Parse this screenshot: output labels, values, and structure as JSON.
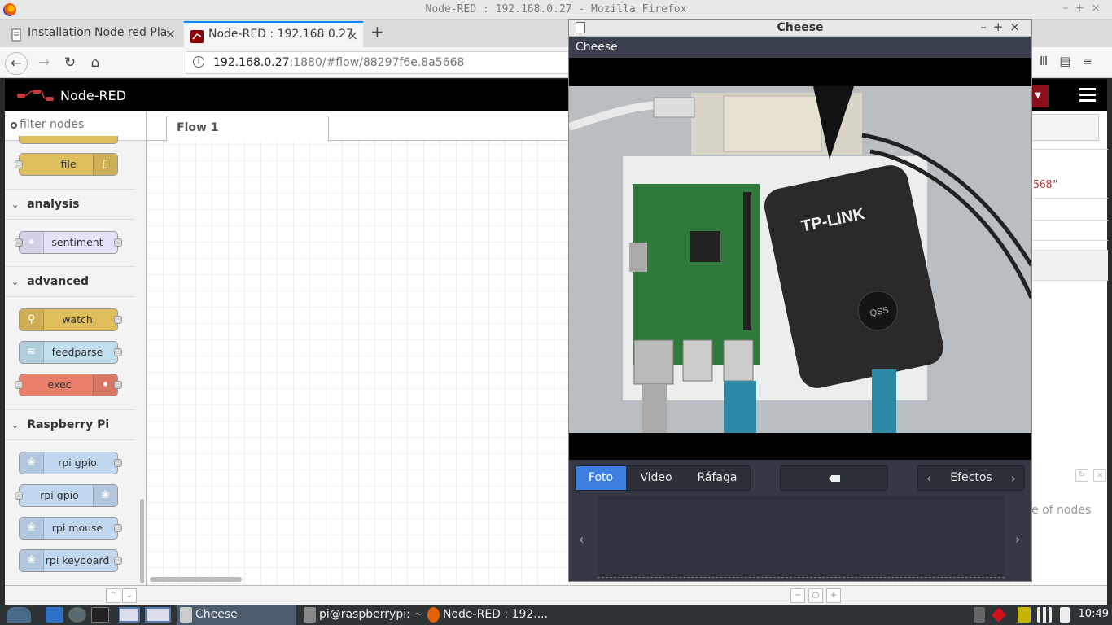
{
  "browser": {
    "window_title": "Node-RED : 192.168.0.27 - Mozilla Firefox",
    "tabs": [
      {
        "label": "Installation Node red Pla",
        "active": false
      },
      {
        "label": "Node-RED : 192.168.0.27",
        "active": true
      }
    ],
    "url_host": "192.168.0.27",
    "url_rest": ":1880/#flow/88297f6e.8a5668"
  },
  "nodered": {
    "app_title": "Node-RED",
    "filter_placeholder": "filter nodes",
    "palette": {
      "nodes_top": [
        {
          "label": "file",
          "color": "#debd5c"
        }
      ],
      "categories": [
        {
          "name": "analysis",
          "nodes": [
            {
              "label": "sentiment",
              "color": "#e6e0f8"
            }
          ]
        },
        {
          "name": "advanced",
          "nodes": [
            {
              "label": "watch",
              "color": "#debd5c"
            },
            {
              "label": "feedparse",
              "color": "#c0deed"
            },
            {
              "label": "exec",
              "color": "#e9806c"
            }
          ]
        },
        {
          "name": "Raspberry Pi",
          "nodes": [
            {
              "label": "rpi gpio",
              "color": "#c0d7ef"
            },
            {
              "label": "rpi gpio",
              "color": "#c0d7ef"
            },
            {
              "label": "rpi mouse",
              "color": "#c0d7ef"
            },
            {
              "label": "rpi keyboard",
              "color": "#c0d7ef"
            }
          ]
        }
      ]
    },
    "flow_tab": "Flow 1",
    "sidebar_code_fragment": "568\"",
    "sidebar_hint_fragment": "e of nodes"
  },
  "cheese": {
    "window_title": "Cheese",
    "header_title": "Cheese",
    "modes": [
      "Foto",
      "Video",
      "Ráfaga"
    ],
    "active_mode": "Foto",
    "effects_label": "Efectos",
    "preview_brand": "TP-LINK",
    "preview_button_label": "QSS"
  },
  "taskbar": {
    "items": [
      "Cheese",
      "pi@raspberrypi: ~",
      "Node-RED : 192...."
    ],
    "clock": "10:49"
  }
}
